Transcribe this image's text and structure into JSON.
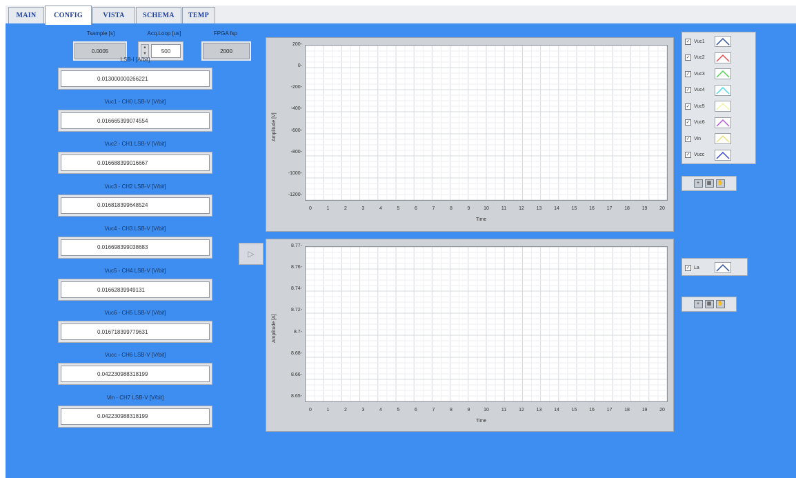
{
  "tabs": [
    "MAIN",
    "CONFIG",
    "VISTA",
    "SCHEMA",
    "TEMP"
  ],
  "active_tab": "CONFIG",
  "top_controls": {
    "tsample_label": "Tsample [s]",
    "tsample_value": "0.0005",
    "acq_label": "Acq.Loop [us]",
    "acq_value": "500",
    "fpga_label": "FPGA fsp",
    "fpga_value": "2000"
  },
  "lsb_fields": [
    {
      "label": "LSB-I [A/bit]",
      "value": "0.013000000266221"
    },
    {
      "label": "Vuc1 - CH0 LSB-V [V/bit]",
      "value": "0.016665399074554"
    },
    {
      "label": "Vuc2 - CH1 LSB-V [V/bit]",
      "value": "0.016688399016667"
    },
    {
      "label": "Vuc3 - CH2 LSB-V [V/bit]",
      "value": "0.016818399648524"
    },
    {
      "label": "Vuc4 - CH3 LSB-V [V/bit]",
      "value": "0.016698399038683"
    },
    {
      "label": "Vuc5 - CH4 LSB-V [V/bit]",
      "value": "0.01662839949131"
    },
    {
      "label": "Vuc6 - CH5 LSB-V [V/bit]",
      "value": "0.016718399779631"
    },
    {
      "label": "Vucc - CH6 LSB-V [V/bit]",
      "value": "0.042230988318199"
    },
    {
      "label": "Vin - CH7 LSB-V [V/bit]",
      "value": "0.042230988318199"
    }
  ],
  "graph1": {
    "ylabel": "Amplitude [V]",
    "xlabel": "Time",
    "yticks": [
      "200-",
      "0-",
      "-200-",
      "-400-",
      "-600-",
      "-800-",
      "-1000-",
      "-1200-"
    ],
    "xticks": [
      "0",
      "1",
      "2",
      "3",
      "4",
      "5",
      "6",
      "7",
      "8",
      "9",
      "10",
      "11",
      "12",
      "13",
      "14",
      "15",
      "16",
      "17",
      "18",
      "19",
      "20"
    ]
  },
  "graph2": {
    "ylabel": "Amplitude [A]",
    "xlabel": "Time",
    "yticks": [
      "8.77-",
      "8.76-",
      "8.74-",
      "8.72-",
      "8.7-",
      "8.68-",
      "8.66-",
      "8.65-"
    ],
    "xticks": [
      "0",
      "1",
      "2",
      "3",
      "4",
      "5",
      "6",
      "7",
      "8",
      "9",
      "10",
      "11",
      "12",
      "13",
      "14",
      "15",
      "16",
      "17",
      "18",
      "19",
      "20"
    ]
  },
  "legend1": [
    {
      "name": "Vuc1",
      "color": "#2a4fa0"
    },
    {
      "name": "Vuc2",
      "color": "#e04a4a"
    },
    {
      "name": "Vuc3",
      "color": "#4fd24f"
    },
    {
      "name": "Vuc4",
      "color": "#4fd8e0"
    },
    {
      "name": "Vuc5",
      "color": "#f1f3a8"
    },
    {
      "name": "Vuc6",
      "color": "#b65ad8"
    },
    {
      "name": "Vin",
      "color": "#e8e07a"
    },
    {
      "name": "Vucc",
      "color": "#3a48c8"
    }
  ],
  "legend2": [
    {
      "name": "La",
      "color": "#2a4fa0"
    }
  ]
}
